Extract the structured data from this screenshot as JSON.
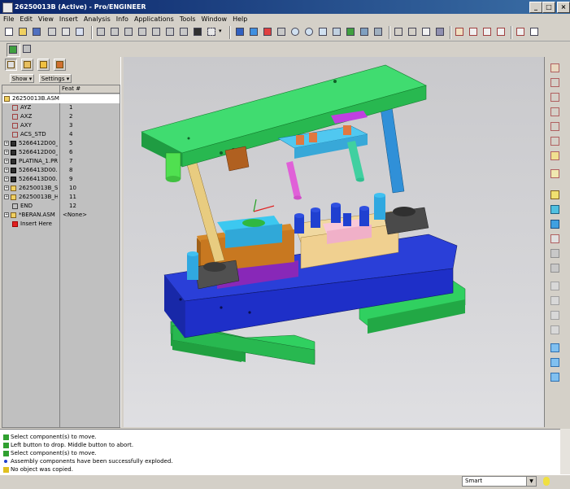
{
  "window": {
    "title": "26250013B (Active) - Pro/ENGINEER"
  },
  "menu": [
    "File",
    "Edit",
    "View",
    "Insert",
    "Analysis",
    "Info",
    "Applications",
    "Tools",
    "Window",
    "Help"
  ],
  "panel": {
    "show_label": "Show",
    "settings_label": "Settings",
    "column_header": "Feat #"
  },
  "tree": [
    {
      "label": "26250013B.ASM",
      "num": "",
      "icon": "assembly-icon"
    },
    {
      "label": "AYZ",
      "num": "1",
      "icon": "datum-plane-icon"
    },
    {
      "label": "AXZ",
      "num": "2",
      "icon": "datum-plane-icon"
    },
    {
      "label": "AXY",
      "num": "3",
      "icon": "datum-plane-icon"
    },
    {
      "label": "ACS_STD",
      "num": "4",
      "icon": "coordinate-system-icon"
    },
    {
      "label": "5266412D00_...",
      "num": "5",
      "icon": "part-icon"
    },
    {
      "label": "5266412D00_...",
      "num": "6",
      "icon": "part-icon"
    },
    {
      "label": "PLATINA_1.PR",
      "num": "7",
      "icon": "part-icon"
    },
    {
      "label": "5266413D00.F",
      "num": "8",
      "icon": "part-icon"
    },
    {
      "label": "5266413D00.F",
      "num": "9",
      "icon": "part-icon"
    },
    {
      "label": "26250013B_SI",
      "num": "10",
      "icon": "assembly-icon"
    },
    {
      "label": "26250013B_H",
      "num": "11",
      "icon": "assembly-icon"
    },
    {
      "label": "END",
      "num": "12",
      "icon": "end-icon"
    },
    {
      "label": "*BERAN.ASM",
      "num": "<None>",
      "icon": "assembly-icon"
    },
    {
      "label": "Insert Here",
      "num": "",
      "icon": "insert-arrow-icon"
    }
  ],
  "messages": [
    {
      "text": "Select component(s) to move.",
      "icon": "prompt-icon"
    },
    {
      "text": "Left button to drop.  Middle button to abort.",
      "icon": "prompt-icon"
    },
    {
      "text": "Select component(s) to move.",
      "icon": "prompt-icon"
    },
    {
      "text": "Assembly components have been successfully exploded.",
      "icon": "info-icon"
    },
    {
      "text": "No object was copied.",
      "icon": "warning-icon"
    }
  ],
  "status": {
    "filter_value": "Smart"
  },
  "colors": {
    "plate_green": "#3cd86a",
    "base_blue": "#1e2fc8",
    "punch_cyan": "#40b8e8",
    "pin_tan": "#f0d090",
    "block_orange": "#c87820",
    "block_purple": "#9a30c8",
    "pink": "#f0b0c8",
    "dark_gray": "#404040"
  }
}
